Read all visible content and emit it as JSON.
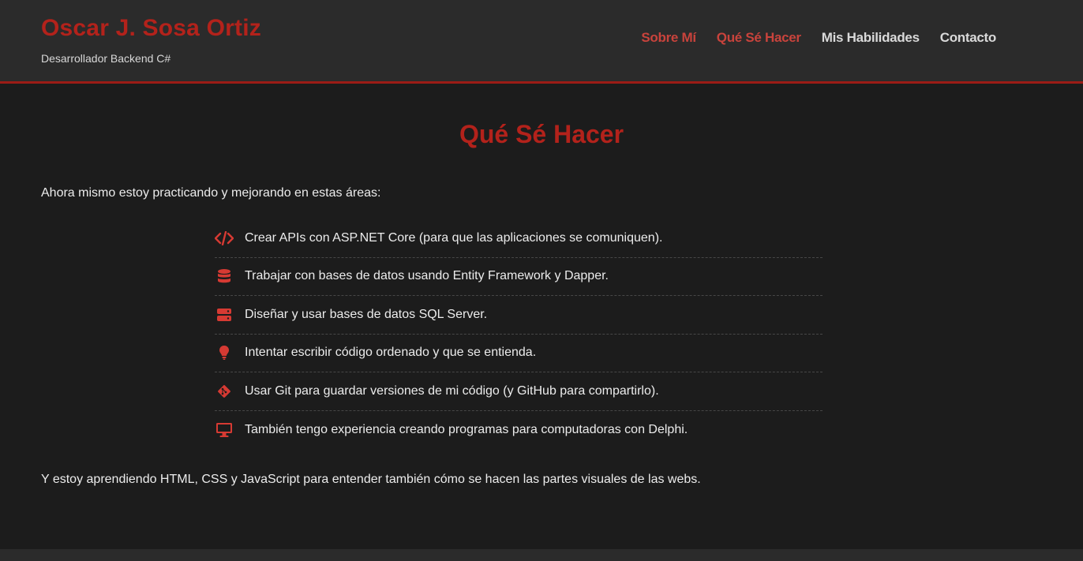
{
  "header": {
    "brand_name": "Oscar J. Sosa Ortiz",
    "brand_subtitle": "Desarrollador Backend C#",
    "nav": [
      {
        "label": "Sobre Mí",
        "active": true
      },
      {
        "label": "Qué Sé Hacer",
        "active": true
      },
      {
        "label": "Mis Habilidades",
        "active": false
      },
      {
        "label": "Contacto",
        "active": false
      }
    ]
  },
  "main": {
    "title": "Qué Sé Hacer",
    "intro": "Ahora mismo estoy practicando y mejorando en estas áreas:",
    "skills": [
      {
        "icon": "code-icon",
        "text": "Crear APIs con ASP.NET Core (para que las aplicaciones se comuniquen)."
      },
      {
        "icon": "database-icon",
        "text": "Trabajar con bases de datos usando Entity Framework y Dapper."
      },
      {
        "icon": "server-icon",
        "text": "Diseñar y usar bases de datos SQL Server."
      },
      {
        "icon": "lightbulb-icon",
        "text": "Intentar escribir código ordenado y que se entienda."
      },
      {
        "icon": "git-icon",
        "text": "Usar Git para guardar versiones de mi código (y GitHub para compartirlo)."
      },
      {
        "icon": "desktop-icon",
        "text": "También tengo experiencia creando programas para computadoras con Delphi."
      }
    ],
    "outro": "Y estoy aprendiendo HTML, CSS y JavaScript para entender también cómo se hacen las partes visuales de las webs."
  },
  "colors": {
    "accent": "#b3221b",
    "accent_light": "#c9433c",
    "icon": "#d63a33",
    "background": "#1c1c1c",
    "header_bg": "#2b2b2b"
  }
}
